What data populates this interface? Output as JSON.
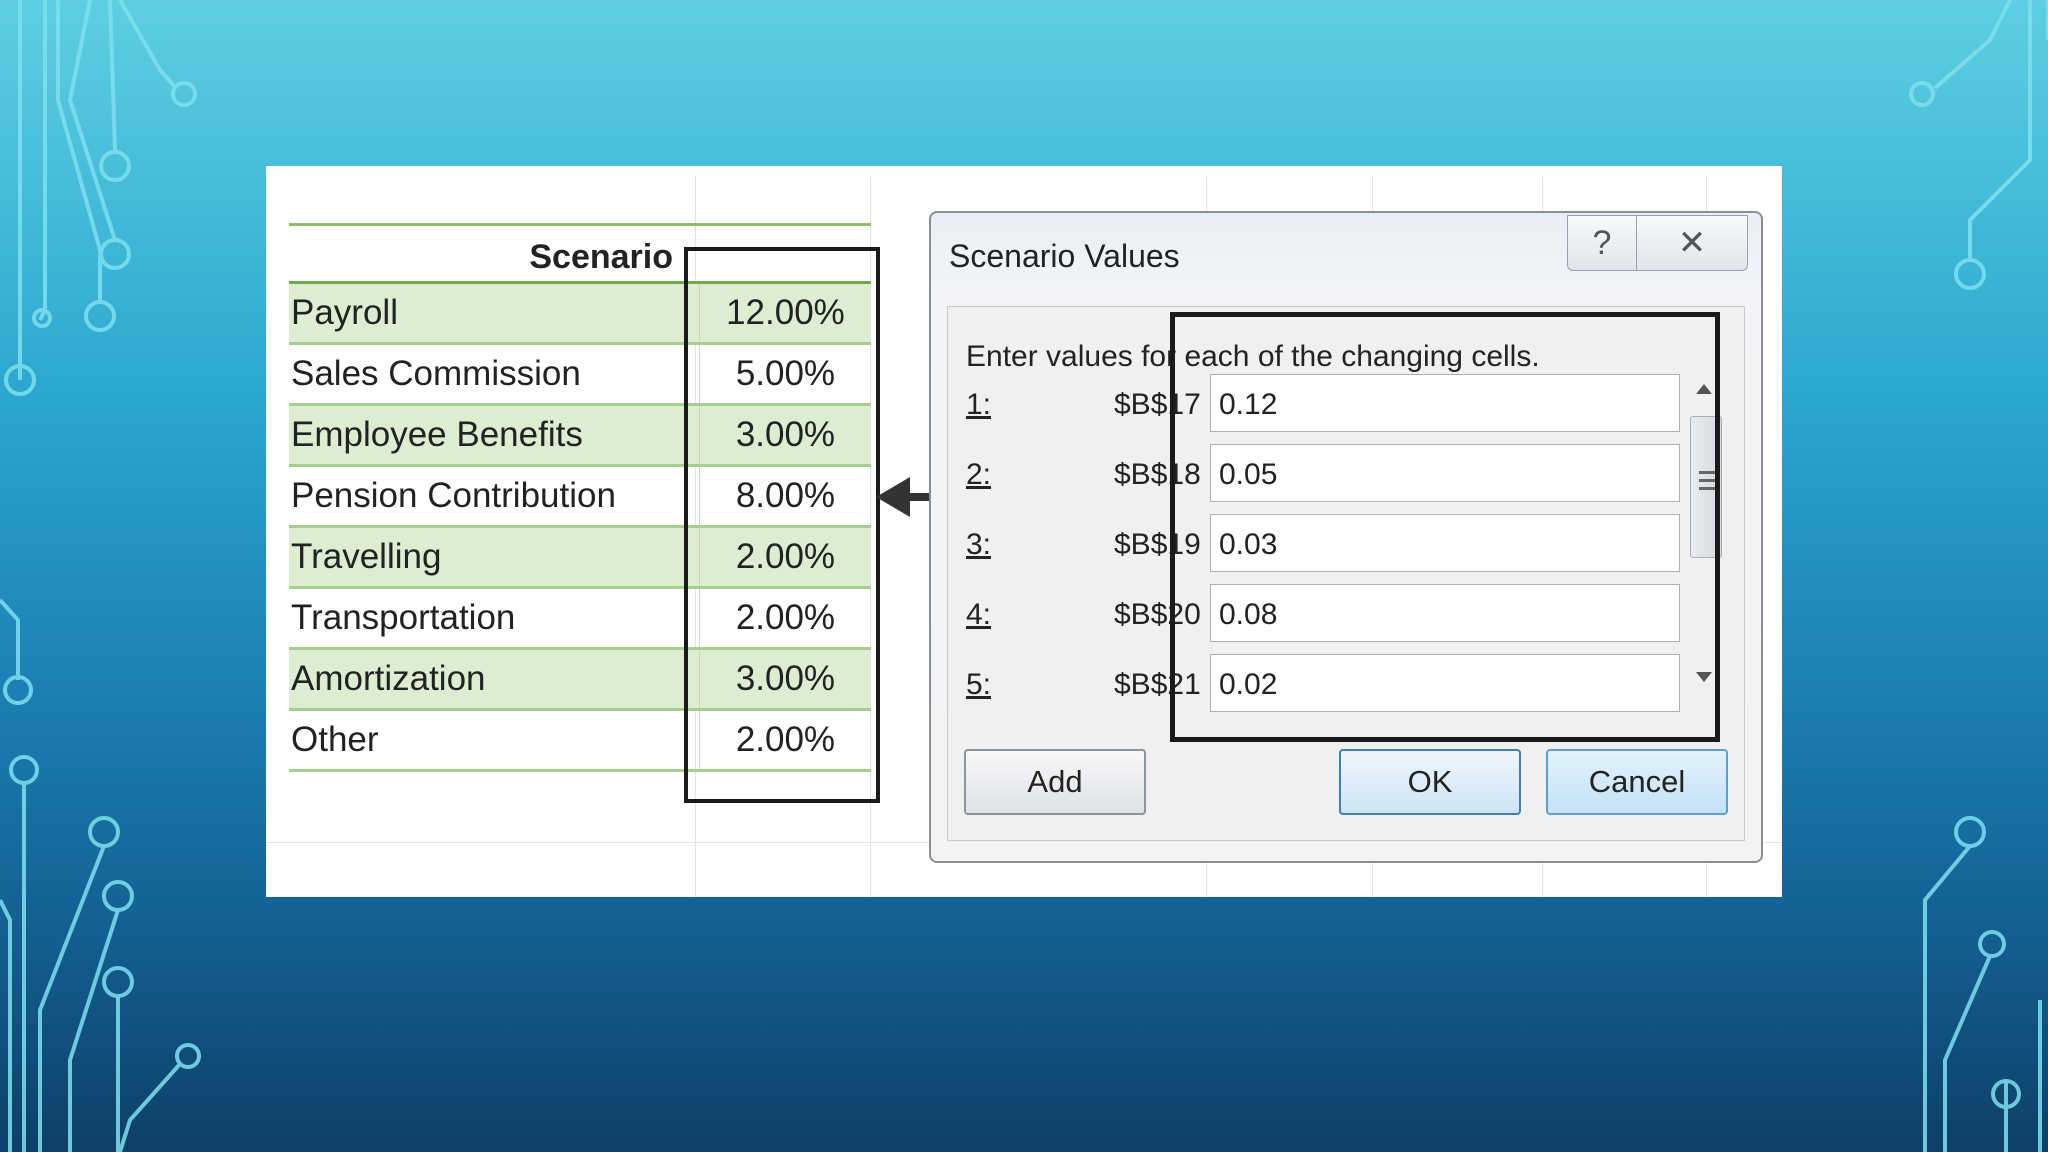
{
  "sheet": {
    "header": "Scenario",
    "rows": [
      {
        "label": "Payroll",
        "value": "12.00%"
      },
      {
        "label": "Sales Commission",
        "value": "5.00%"
      },
      {
        "label": "Employee Benefits",
        "value": "3.00%"
      },
      {
        "label": "Pension Contribution",
        "value": "8.00%"
      },
      {
        "label": "Travelling",
        "value": "2.00%"
      },
      {
        "label": "Transportation",
        "value": "2.00%"
      },
      {
        "label": "Amortization",
        "value": "3.00%"
      },
      {
        "label": "Other",
        "value": "2.00%"
      }
    ]
  },
  "dialog": {
    "title": "Scenario Values",
    "help_glyph": "?",
    "close_glyph": "✕",
    "prompt": "Enter values for each of the changing cells.",
    "fields": [
      {
        "num": "1:",
        "ref": "$B$17",
        "value": "0.12"
      },
      {
        "num": "2:",
        "ref": "$B$18",
        "value": "0.05"
      },
      {
        "num": "3:",
        "ref": "$B$19",
        "value": "0.03"
      },
      {
        "num": "4:",
        "ref": "$B$20",
        "value": "0.08"
      },
      {
        "num": "5:",
        "ref": "$B$21",
        "value": "0.02"
      }
    ],
    "add_label": "Add",
    "ok_label": "OK",
    "cancel_label": "Cancel"
  },
  "colors": {
    "row_green": "#dcedd1",
    "row_border": "#a6cf8e",
    "header_border": "#6fab4e",
    "ok_border": "#3c7fb1"
  }
}
